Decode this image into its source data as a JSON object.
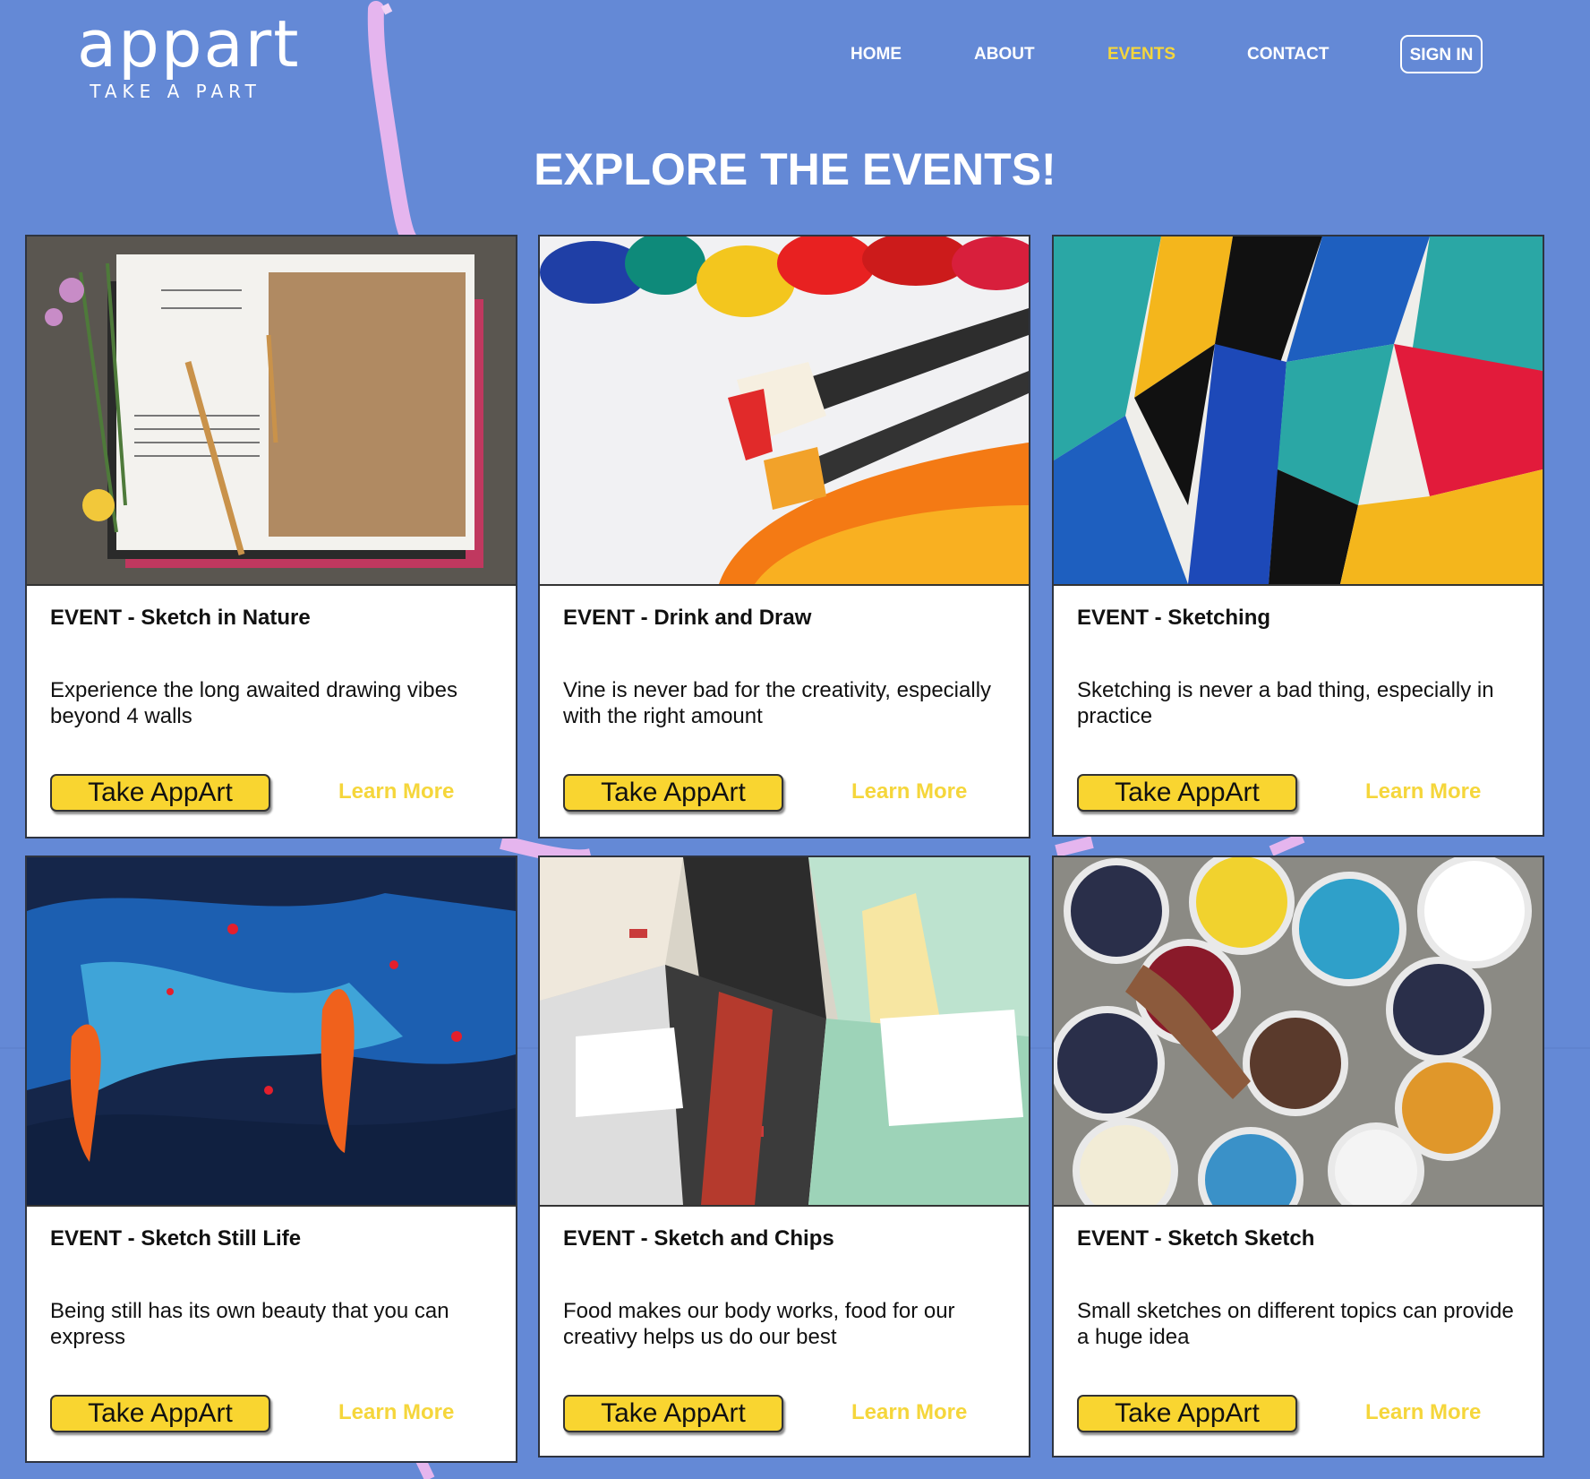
{
  "brand": {
    "name": "appart",
    "tagline": "TAKE A PART"
  },
  "nav": {
    "items": [
      {
        "label": "HOME"
      },
      {
        "label": "ABOUT"
      },
      {
        "label": "EVENTS",
        "active": true
      },
      {
        "label": "CONTACT"
      }
    ],
    "signin_label": "SIGN IN"
  },
  "page": {
    "title": "EXPLORE THE EVENTS!"
  },
  "colors": {
    "background": "#6489d6",
    "accent": "#f5d63b",
    "button": "#f9d530",
    "decor": "#e5b5ee"
  },
  "events": [
    {
      "title": "EVENT - Sketch in Nature",
      "description": "Experience the long awaited drawing vibes beyond 4 walls",
      "primary_label": "Take AppArt",
      "secondary_label": "Learn More",
      "image": "sketchbook-flowers-photo"
    },
    {
      "title": "EVENT - Drink and Draw",
      "description": "Vine is never bad for the creativity, especially with the right amount",
      "primary_label": "Take AppArt",
      "secondary_label": "Learn More",
      "image": "paintbrushes-paint-photo"
    },
    {
      "title": "EVENT - Sketching",
      "description": "Sketching is never a bad thing, especially in practice",
      "primary_label": "Take AppArt",
      "secondary_label": "Learn More",
      "image": "geometric-mural-photo"
    },
    {
      "title": "EVENT - Sketch Still Life",
      "description": "Being still has its own beauty that you can express",
      "primary_label": "Take AppArt",
      "secondary_label": "Learn More",
      "image": "abstract-painting-photo"
    },
    {
      "title": "EVENT - Sketch and Chips",
      "description": "Food makes our body works, food for our creativy helps us do our best",
      "primary_label": "Take AppArt",
      "secondary_label": "Learn More",
      "image": "torn-posters-photo"
    },
    {
      "title": "EVENT - Sketch Sketch",
      "description": "Small sketches on different topics can provide a huge idea",
      "primary_label": "Take AppArt",
      "secondary_label": "Learn More",
      "image": "paint-buckets-photo"
    }
  ]
}
